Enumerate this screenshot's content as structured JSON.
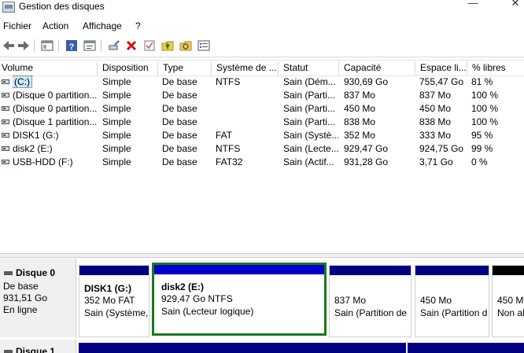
{
  "window": {
    "title": "Gestion des disques",
    "controls": {
      "minimize": "—",
      "close": "✕"
    }
  },
  "menu": [
    "Fichier",
    "Action",
    "Affichage",
    "?"
  ],
  "toolbar": {
    "buttons": [
      "back-arrow",
      "forward-arrow",
      "console-tree",
      "help",
      "properties",
      "connect",
      "delete",
      "check",
      "up-folder",
      "folder-search",
      "list-view"
    ]
  },
  "list": {
    "columns": [
      "Volume",
      "Disposition",
      "Type",
      "Système de ...",
      "Statut",
      "Capacité",
      "Espace li...",
      "% libres"
    ],
    "rows": [
      [
        "(C:)",
        "Simple",
        "De base",
        "NTFS",
        "Sain (Dém...",
        "930,69 Go",
        "755,47 Go",
        "81 %"
      ],
      [
        "(Disque 0 partition...",
        "Simple",
        "De base",
        "",
        "Sain (Parti...",
        "837 Mo",
        "837 Mo",
        "100 %"
      ],
      [
        "(Disque 0 partition...",
        "Simple",
        "De base",
        "",
        "Sain (Parti...",
        "450 Mo",
        "450 Mo",
        "100 %"
      ],
      [
        "(Disque 1 partition...",
        "Simple",
        "De base",
        "",
        "Sain (Parti...",
        "838 Mo",
        "838 Mo",
        "100 %"
      ],
      [
        "DISK1 (G:)",
        "Simple",
        "De base",
        "FAT",
        "Sain (Systè...",
        "352 Mo",
        "333 Mo",
        "95 %"
      ],
      [
        "disk2 (E:)",
        "Simple",
        "De base",
        "NTFS",
        "Sain (Lecte...",
        "929,47 Go",
        "924,75 Go",
        "99 %"
      ],
      [
        "USB-HDD (F:)",
        "Simple",
        "De base",
        "FAT32",
        "Sain (Actif...",
        "931,28 Go",
        "3,71 Go",
        "0 %"
      ]
    ]
  },
  "colors": {
    "primary_bar": "#0000cc",
    "logical_bar": "#000080",
    "unallocated_bar": "#000000",
    "selection": "#1a7a1a"
  },
  "disks": [
    {
      "name": "Disque 0",
      "lines": [
        "De base",
        "931,51 Go",
        "En ligne"
      ],
      "partitions": [
        {
          "lines": [
            "DISK1  (G:)",
            "352 Mo FAT",
            "Sain (Système,"
          ],
          "bar": "logical"
        },
        {
          "lines": [
            "disk2  (E:)",
            "929,47 Go NTFS",
            "Sain (Lecteur logique)"
          ],
          "bar": "primary",
          "selected": true
        },
        {
          "lines": [
            "",
            "837 Mo",
            "Sain (Partition de"
          ],
          "bar": "logical"
        },
        {
          "lines": [
            "",
            "450 Mo",
            "Sain (Partition d"
          ],
          "bar": "logical"
        },
        {
          "lines": [
            "",
            "450 Mo",
            "Non al"
          ],
          "bar": "unallocated"
        }
      ]
    },
    {
      "name": "Disque 1"
    }
  ]
}
